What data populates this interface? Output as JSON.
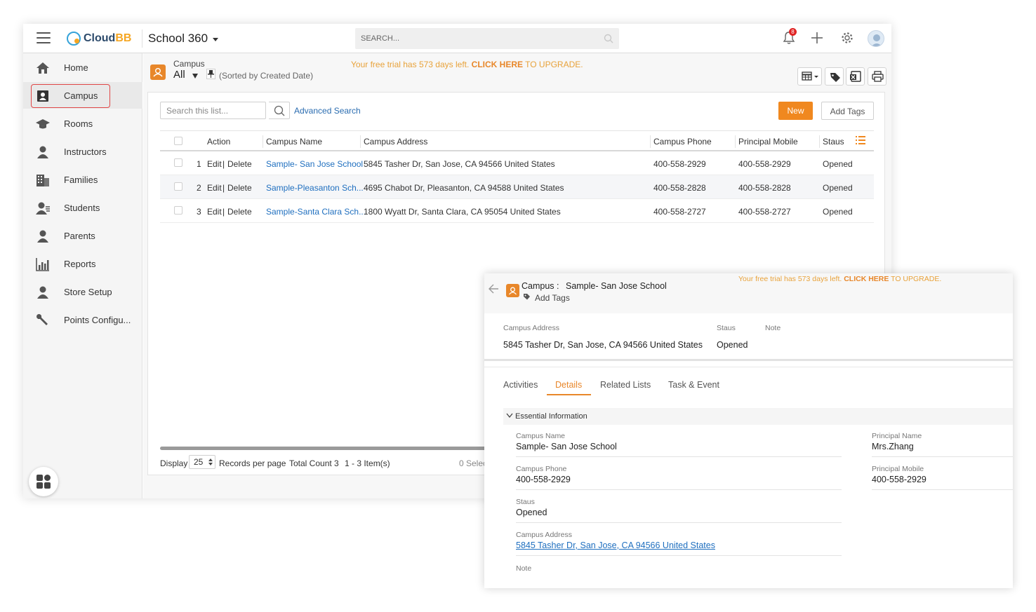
{
  "app": {
    "logo_part1": "Cloud",
    "logo_part2": "BB",
    "title": "School 360",
    "search_placeholder": "SEARCH...",
    "notification_count": "8"
  },
  "sidebar": {
    "items": [
      {
        "label": "Home",
        "icon": "home-icon"
      },
      {
        "label": "Campus",
        "icon": "campus-icon"
      },
      {
        "label": "Rooms",
        "icon": "graduation-cap-icon"
      },
      {
        "label": "Instructors",
        "icon": "person-icon"
      },
      {
        "label": "Families",
        "icon": "building-icon"
      },
      {
        "label": "Students",
        "icon": "student-icon"
      },
      {
        "label": "Parents",
        "icon": "person-icon"
      },
      {
        "label": "Reports",
        "icon": "bar-chart-icon"
      },
      {
        "label": "Store Setup",
        "icon": "person-icon"
      },
      {
        "label": "Points Configu...",
        "icon": "wrench-icon"
      }
    ],
    "active": "Campus"
  },
  "list": {
    "module": "Campus",
    "view": "All",
    "sorted": "(Sorted by Created Date)",
    "trial_prefix": "Your free trial has 573 days left.",
    "trial_link": "CLICK HERE",
    "trial_suffix": "TO UPGRADE.",
    "search_placeholder": "Search this list...",
    "advanced_search": "Advanced Search",
    "new_label": "New",
    "add_tags_label": "Add Tags",
    "columns": [
      "Action",
      "Campus Name",
      "Campus Address",
      "Campus Phone",
      "Principal Mobile",
      "Staus"
    ],
    "rows": [
      {
        "num": "1",
        "edit": "Edit",
        "sep": "|",
        "delete": "Delete",
        "name": "Sample- San Jose School",
        "address": "5845 Tasher Dr, San Jose, CA 94566 United States",
        "phone": "400-558-2929",
        "mobile": "400-558-2929",
        "status": "Opened"
      },
      {
        "num": "2",
        "edit": "Edit",
        "sep": "|",
        "delete": "Delete",
        "name": "Sample-Pleasanton Sch...",
        "address": "4695 Chabot Dr, Pleasanton, CA 94588 United States",
        "phone": "400-558-2828",
        "mobile": "400-558-2828",
        "status": "Opened"
      },
      {
        "num": "3",
        "edit": "Edit",
        "sep": "|",
        "delete": "Delete",
        "name": "Sample-Santa Clara Sch...",
        "address": "1800 Wyatt Dr, Santa Clara, CA 95054 United States",
        "phone": "400-558-2727",
        "mobile": "400-558-2727",
        "status": "Opened"
      }
    ],
    "footer": {
      "display": "Display",
      "page_size": "25",
      "records_per_page": "Records per page",
      "total_count": "Total Count 3",
      "items": "1 - 3 Item(s)",
      "selected": "0 Selec"
    }
  },
  "detail": {
    "title_label": "Campus :",
    "title_value": "Sample- San Jose School",
    "add_tags": "Add Tags",
    "trial_prefix": "Your free trial has 573 days left.",
    "trial_link": "CLICK HERE",
    "trial_suffix": "TO UPGRADE.",
    "summary": {
      "address_label": "Campus Address",
      "address_value": "5845 Tasher Dr, San Jose, CA 94566 United States",
      "status_label": "Staus",
      "status_value": "Opened",
      "note_label": "Note"
    },
    "tabs": [
      "Activities",
      "Details",
      "Related Lists",
      "Task & Event"
    ],
    "active_tab": "Details",
    "section": "Essential Information",
    "fields": {
      "campus_name_label": "Campus Name",
      "campus_name_value": "Sample- San Jose School",
      "campus_phone_label": "Campus Phone",
      "campus_phone_value": "400-558-2929",
      "status_label": "Staus",
      "status_value": "Opened",
      "campus_address_label": "Campus Address",
      "campus_address_value": "5845 Tasher Dr, San Jose, CA 94566 United States",
      "note_label": "Note",
      "principal_name_label": "Principal Name",
      "principal_name_value": "Mrs.Zhang",
      "principal_mobile_label": "Principal Mobile",
      "principal_mobile_value": "400-558-2929"
    }
  },
  "colors": {
    "accent": "#f0881f",
    "link": "#1f6fbf",
    "active_outline": "#e04747",
    "trial": "#e8a23a"
  }
}
